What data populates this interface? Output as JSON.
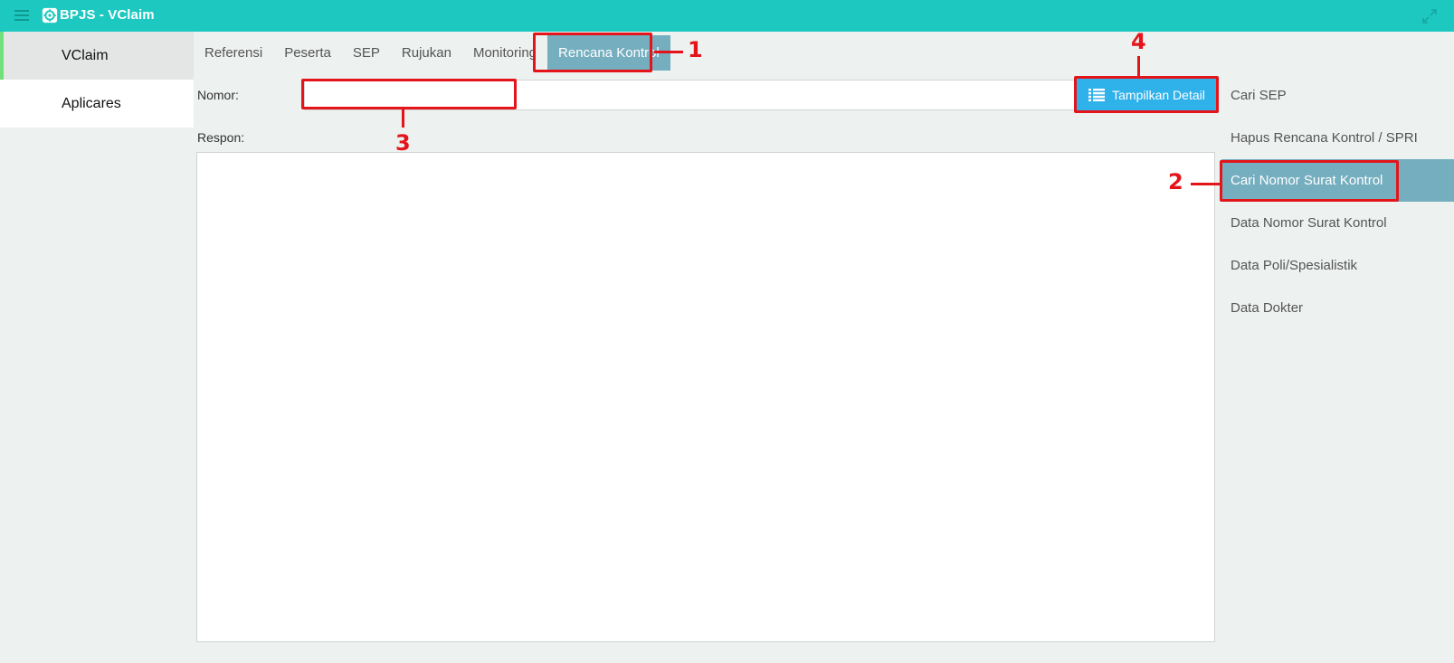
{
  "window": {
    "title": "BPJS - VClaim",
    "menu_icon": "hamburger-menu-icon",
    "logo_icon": "gear-icon",
    "expand_icon": "expand-arrows-icon"
  },
  "left_nav": {
    "items": [
      {
        "label": "VClaim",
        "active": true
      },
      {
        "label": "Aplicares",
        "active": false
      }
    ]
  },
  "tabs": [
    {
      "label": "Referensi"
    },
    {
      "label": "Peserta"
    },
    {
      "label": "SEP"
    },
    {
      "label": "Rujukan"
    },
    {
      "label": "Monitoring"
    },
    {
      "label": "Rencana Kontrol",
      "active": true
    }
  ],
  "form": {
    "nomor_label": "Nomor:",
    "nomor_value": "",
    "respon_label": "Respon:",
    "button_label": "Tampilkan Detail",
    "button_icon": "list-icon"
  },
  "side_menu": {
    "items": [
      {
        "label": "Cari SEP"
      },
      {
        "label": "Hapus Rencana Kontrol / SPRI"
      },
      {
        "label": "Cari Nomor Surat Kontrol",
        "active": true
      },
      {
        "label": "Data Nomor Surat Kontrol"
      },
      {
        "label": "Data Poli/Spesialistik"
      },
      {
        "label": "Data Dokter"
      }
    ]
  },
  "annotations": {
    "n1": "1",
    "n2": "2",
    "n3": "3",
    "n4": "4"
  },
  "colors": {
    "titlebar": "#1dc8c0",
    "active_tab": "#74aebf",
    "button": "#2fb1ea",
    "annotation": "#e4141b",
    "nav_accent": "#72e07a"
  }
}
